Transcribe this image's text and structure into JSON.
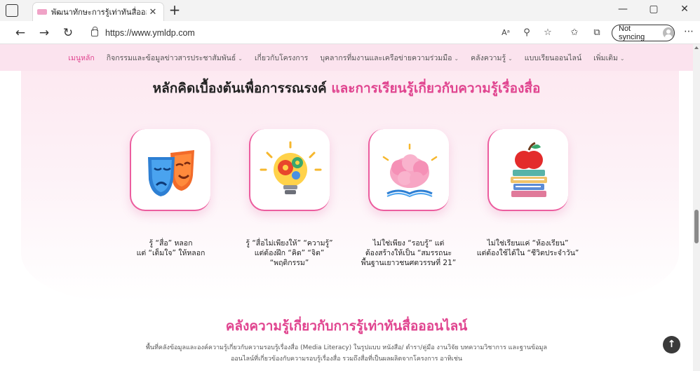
{
  "browser": {
    "tab_title": "พัฒนาทักษะการรู้เท่าทันสื่อออนไลน์ ใน",
    "tab_close": "✕",
    "new_tab": "+",
    "url": "https://www.ymldp.com",
    "sync_label": "Not syncing",
    "icons": [
      "back-icon",
      "forward-icon",
      "refresh-icon",
      "lock-icon",
      "read-aloud-icon",
      "zoom-icon",
      "favorite-add-icon",
      "favorites-icon",
      "collections-icon",
      "more-icon"
    ]
  },
  "site_nav": {
    "items": [
      {
        "label": "เมนูหลัก",
        "active": true,
        "has_dropdown": false
      },
      {
        "label": "กิจกรรมและข้อมูลข่าวสารประชาสัมพันธ์",
        "active": false,
        "has_dropdown": true
      },
      {
        "label": "เกี่ยวกับโครงการ",
        "active": false,
        "has_dropdown": false
      },
      {
        "label": "บุคลากรที่มงานและเครือข่ายความร่วมมือ",
        "active": false,
        "has_dropdown": true
      },
      {
        "label": "คลังความรู้",
        "active": false,
        "has_dropdown": true
      },
      {
        "label": "แบบเรียนออนไลน์",
        "active": false,
        "has_dropdown": false
      },
      {
        "label": "เพิ่มเติม",
        "active": false,
        "has_dropdown": true
      }
    ],
    "accent_color": "#e0448f",
    "background_color": "#fbe3ee"
  },
  "principles": {
    "title_main": "หลักคิดเบื้องต้นเพื่อการรณรงค์",
    "title_accent": "และการเรียนรู้เกี่ยวกับความรู้เรื่องสื่อ",
    "cards": [
      {
        "icon": "theater-masks-icon",
        "line1": "รู้ “สื่อ” หลอก",
        "line2": "แต่ “เต็มใจ” ให้หลอก",
        "line3": ""
      },
      {
        "icon": "lightbulb-gears-icon",
        "line1": "รู้ “สื่อไม่เพียงให้” “ความรู้”",
        "line2": "แต่ต้องฝึก “คิด” “จิต”",
        "line3": "“พฤติกรรม”"
      },
      {
        "icon": "brain-book-icon",
        "line1": "ไม่ใช่เพียง “รอบรู้” แต่",
        "line2": "ต้องสร้างให้เป็น “สมรรถนะ",
        "line3": "พื้นฐานเยาวชนศตวรรษที่ 21”"
      },
      {
        "icon": "apple-books-icon",
        "line1": "ไม่ใช่เรียนแค่ “ห้องเรียน”",
        "line2": "แต่ต้องใช้ได้ใน “ชีวิตประจำวัน”",
        "line3": ""
      }
    ]
  },
  "library": {
    "title": "คลังความรู้เกี่ยวกับการรู้เท่าทันสื่อออนไลน์",
    "desc_line1": "พื้นที่คลังข้อมูลและองค์ความรู้เกี่ยวกับความรอบรู้เรื่องสื่อ (Media Literacy) ในรูปแบบ หนังสือ/ ตำรา/คู่มือ งานวิจัย บทความวิชาการ และฐานข้อมูล",
    "desc_line2": "ออนไลน์ที่เกี่ยวข้องกับความรอบรู้เรื่องสื่อ รวมถึงสื่อที่เป็นผลผลิตจากโครงการ อาทิเช่น"
  }
}
